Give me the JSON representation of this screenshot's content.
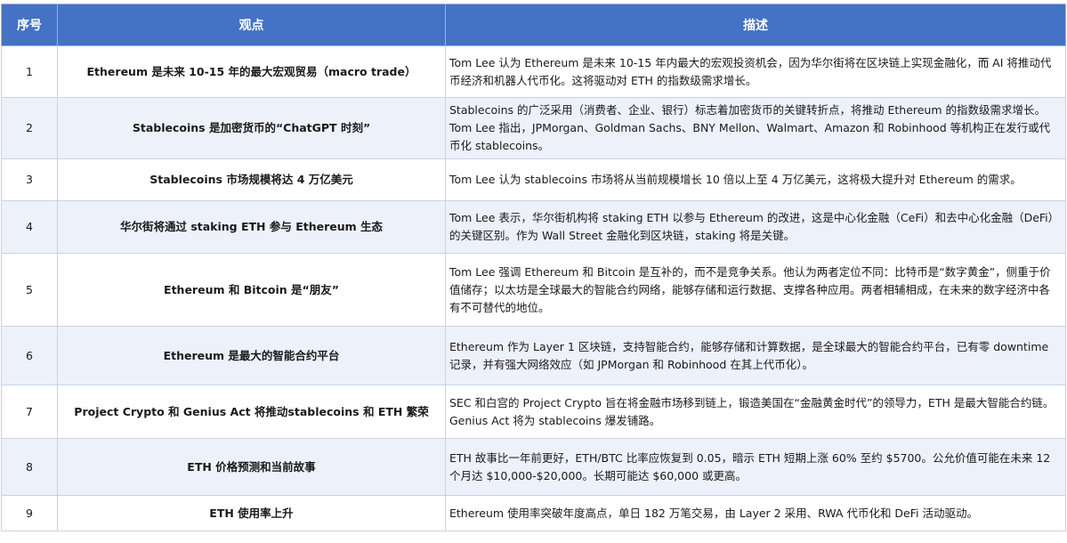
{
  "table": {
    "headers": {
      "index": "序号",
      "view": "观点",
      "description": "描述"
    },
    "rows": [
      {
        "index": "1",
        "view": "Ethereum 是未来 10-15 年的最大宏观贸易（macro trade）",
        "description": "Tom Lee 认为 Ethereum 是未来 10-15 年内最大的宏观投资机会，因为华尔街将在区块链上实现金融化，而 AI 将推动代币经济和机器人代币化。这将驱动对 ETH 的指数级需求增长。"
      },
      {
        "index": "2",
        "view": "Stablecoins 是加密货币的“ChatGPT 时刻”",
        "description": "Stablecoins 的广泛采用（消费者、企业、银行）标志着加密货币的关键转折点，将推动 Ethereum 的指数级需求增长。Tom Lee 指出，JPMorgan、Goldman Sachs、BNY Mellon、Walmart、Amazon 和 Robinhood 等机构正在发行或代币化 stablecoins。"
      },
      {
        "index": "3",
        "view": "Stablecoins 市场规模将达 4 万亿美元",
        "description": "Tom Lee 认为 stablecoins 市场将从当前规模增长 10 倍以上至 4 万亿美元，这将极大提升对 Ethereum 的需求。"
      },
      {
        "index": "4",
        "view": "华尔街将通过 staking ETH 参与 Ethereum 生态",
        "description": "Tom Lee 表示，华尔街机构将 staking ETH 以参与 Ethereum 的改进，这是中心化金融（CeFi）和去中心化金融（DeFi）的关键区别。作为 Wall Street 金融化到区块链，staking 将是关键。"
      },
      {
        "index": "5",
        "view": "Ethereum 和 Bitcoin 是“朋友”",
        "description": "Tom Lee 强调 Ethereum 和 Bitcoin 是互补的，而不是竞争关系。他认为两者定位不同：比特币是“数字黄金”，侧重于价值储存；以太坊是全球最大的智能合约网络，能够存储和运行数据、支撑各种应用。两者相辅相成，在未来的数字经济中各有不可替代的地位。"
      },
      {
        "index": "6",
        "view": "Ethereum 是最大的智能合约平台",
        "description": "Ethereum 作为 Layer 1 区块链，支持智能合约，能够存储和计算数据，是全球最大的智能合约平台，已有零 downtime 记录，并有强大网络效应（如 JPMorgan 和 Robinhood 在其上代币化）。"
      },
      {
        "index": "7",
        "view": "Project Crypto 和 Genius Act 将推动stablecoins 和 ETH 繁荣",
        "description": "SEC 和白宫的 Project Crypto 旨在将金融市场移到链上，锻造美国在“金融黄金时代”的领导力，ETH 是最大智能合约链。Genius Act 将为 stablecoins 爆发铺路。"
      },
      {
        "index": "8",
        "view": "ETH 价格预测和当前故事",
        "description": "ETH 故事比一年前更好，ETH/BTC 比率应恢复到 0.05，暗示 ETH 短期上涨 60% 至约 $5700。公允价值可能在未来 12 个月达 $10,000-$20,000。长期可能达 $60,000 或更高。"
      },
      {
        "index": "9",
        "view": "ETH 使用率上升",
        "description": "Ethereum 使用率突破年度高点，单日 182 万笔交易，由 Layer 2 采用、RWA 代币化和 DeFi 活动驱动。"
      }
    ]
  }
}
